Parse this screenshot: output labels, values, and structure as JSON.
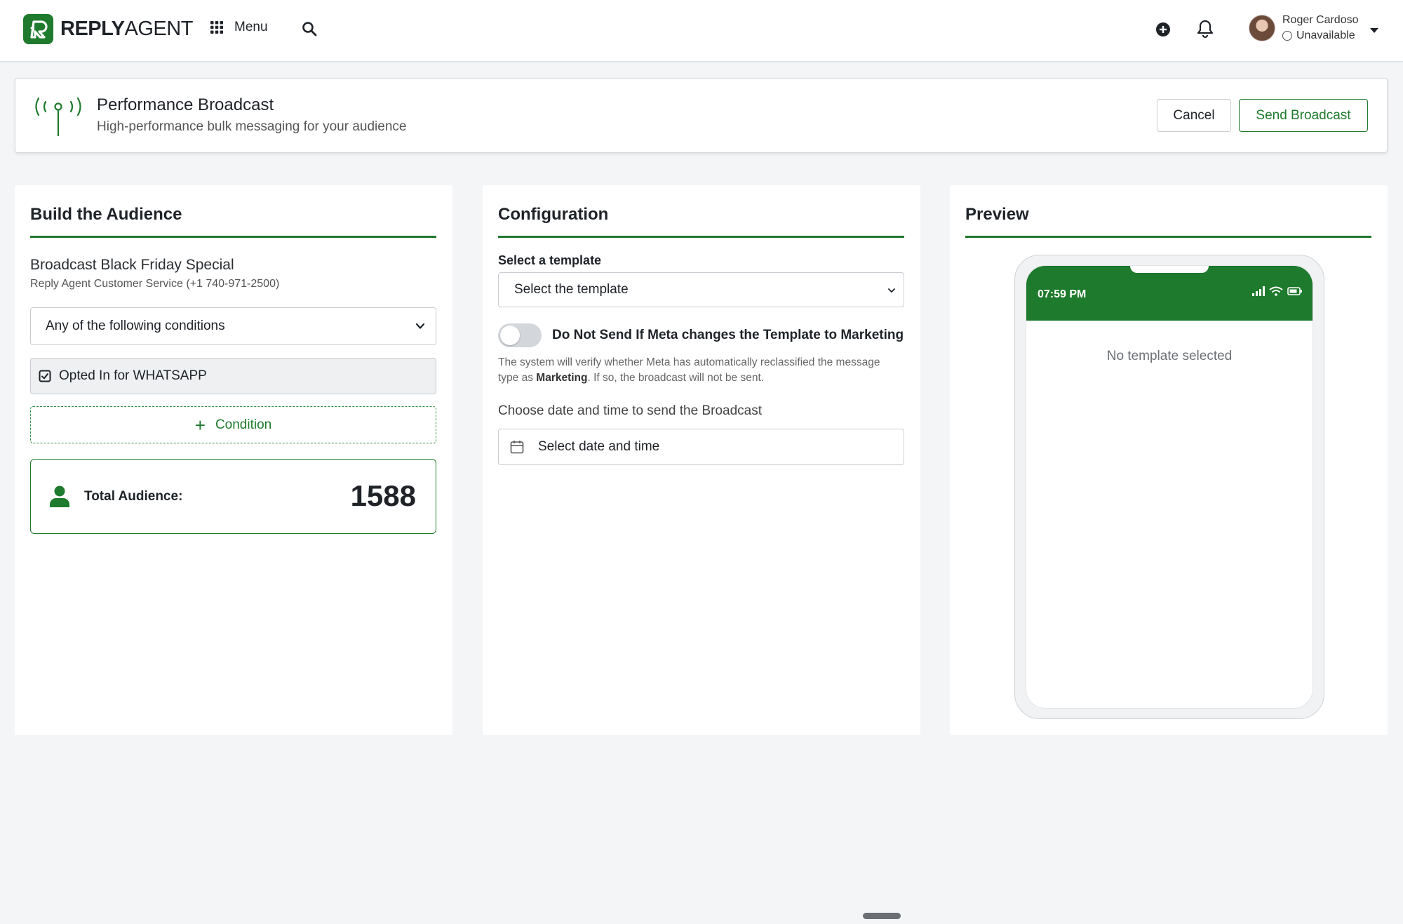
{
  "brand": {
    "logo_bold": "REPLY",
    "logo_light": "AGENT",
    "accent_color": "#1e7a2c"
  },
  "nav": {
    "menu_label": "Menu",
    "user_name": "Roger Cardoso",
    "user_status": "Unavailable",
    "icons": [
      "grid-icon",
      "search-icon",
      "plus-circle-icon",
      "bell-icon",
      "chevron-down-icon"
    ]
  },
  "header": {
    "title": "Performance Broadcast",
    "subtitle": "High-performance bulk messaging for your audience",
    "cancel_label": "Cancel",
    "send_label": "Send Broadcast"
  },
  "audience": {
    "title": "Build the Audience",
    "broadcast_name": "Broadcast Black Friday Special",
    "channel": "Reply Agent Customer Service (+1 740-971-2500)",
    "condition_mode": "Any of the following conditions",
    "conditions": [
      "Opted In for WHATSAPP"
    ],
    "add_condition_label": "Condition",
    "total_label": "Total Audience:",
    "total_value": "1588"
  },
  "config": {
    "title": "Configuration",
    "template_label": "Select a template",
    "template_value": "Select the template",
    "toggle_label": "Do Not Send If Meta changes the Template to Marketing",
    "toggle_on": false,
    "help_prefix": "The system will verify whether Meta has automatically reclassified the message type as ",
    "help_bold": "Marketing",
    "help_suffix": ". If so, the broadcast will not be sent.",
    "date_label": "Choose date and time to send the Broadcast",
    "date_placeholder": "Select date and time"
  },
  "preview": {
    "title": "Preview",
    "phone_time": "07:59 PM",
    "empty_text": "No template selected"
  }
}
